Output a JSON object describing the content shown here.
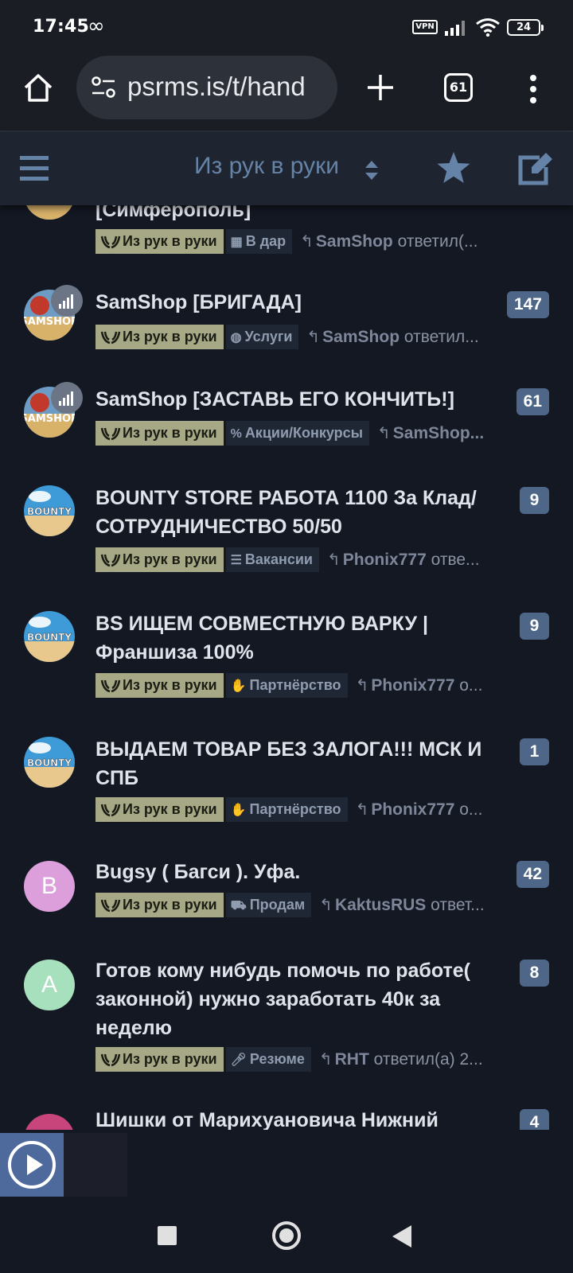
{
  "status_bar": {
    "time": "17:45",
    "extra_icon": "infinity-icon",
    "vpn": "VPN",
    "battery": "24"
  },
  "browser": {
    "url": "psrms.is/t/hand",
    "tab_count": "61"
  },
  "forum_header": {
    "title": "Из рук в руки"
  },
  "topics": [
    {
      "title": "[Симферополь]",
      "count": "",
      "category": "Из рук в руки",
      "subcategory": "В дар",
      "sub_icon": "gift-icon",
      "reply_user": "SamShop",
      "reply_text": "ответил(..."
    },
    {
      "title": "SamShop [БРИГАДА]",
      "count": "147",
      "category": "Из рук в руки",
      "subcategory": "Услуги",
      "sub_icon": "globe-icon",
      "reply_user": "SamShop",
      "reply_text": "ответил..."
    },
    {
      "title": "SamShop [ЗАСТАВЬ ЕГО КОНЧИТЬ!]",
      "count": "61",
      "category": "Из рук в руки",
      "subcategory": "Акции/Конкурсы",
      "sub_icon": "percent-icon",
      "reply_user": "SamShop...",
      "reply_text": ""
    },
    {
      "title": "BOUNTY STORE РАБОТА 1100 За Клад/СОТРУДНИЧЕСТВО 50/50",
      "count": "9",
      "category": "Из рук в руки",
      "subcategory": "Вакансии",
      "sub_icon": "newspaper-icon",
      "reply_user": "Phonix777",
      "reply_text": "отве..."
    },
    {
      "title": "BS ИЩЕМ СОВМЕСТНУЮ ВАРКУ | Франшиза 100%",
      "count": "9",
      "category": "Из рук в руки",
      "subcategory": "Партнёрство",
      "sub_icon": "handshake-icon",
      "reply_user": "Phonix777",
      "reply_text": "о..."
    },
    {
      "title": "ВЫДАЕМ ТОВАР БЕЗ ЗАЛОГА!!! МСК И СПБ",
      "count": "1",
      "category": "Из рук в руки",
      "subcategory": "Партнёрство",
      "sub_icon": "handshake-icon",
      "reply_user": "Phonix777",
      "reply_text": "о..."
    },
    {
      "title": "Bugsy ( Багси ). Уфа.",
      "count": "42",
      "category": "Из рук в руки",
      "subcategory": "Продам",
      "sub_icon": "cart-icon",
      "reply_user": "KaktusRUS",
      "reply_text": "ответ..."
    },
    {
      "title": "Готов кому нибудь помочь по работе( законной) нужно заработать 40к за неделю",
      "count": "8",
      "category": "Из рук в руки",
      "subcategory": "Резюме",
      "sub_icon": "microphone-icon",
      "reply_user": "RHT",
      "reply_text": "ответил(а) 2..."
    },
    {
      "title": "Шишки от Марихуановича Нижний Новгород",
      "count": "4",
      "category": "",
      "subcategory": "",
      "sub_icon": "",
      "reply_user": "",
      "reply_text": ""
    }
  ],
  "avatars": [
    {
      "letter": "B",
      "color": "#dc9fdc"
    },
    {
      "letter": "A",
      "color": "#a7e0bc"
    }
  ],
  "colors": {
    "category_tag": "#a7a986",
    "count_badge": "#4e6687",
    "header_title": "#6582a7",
    "background": "#141822"
  }
}
